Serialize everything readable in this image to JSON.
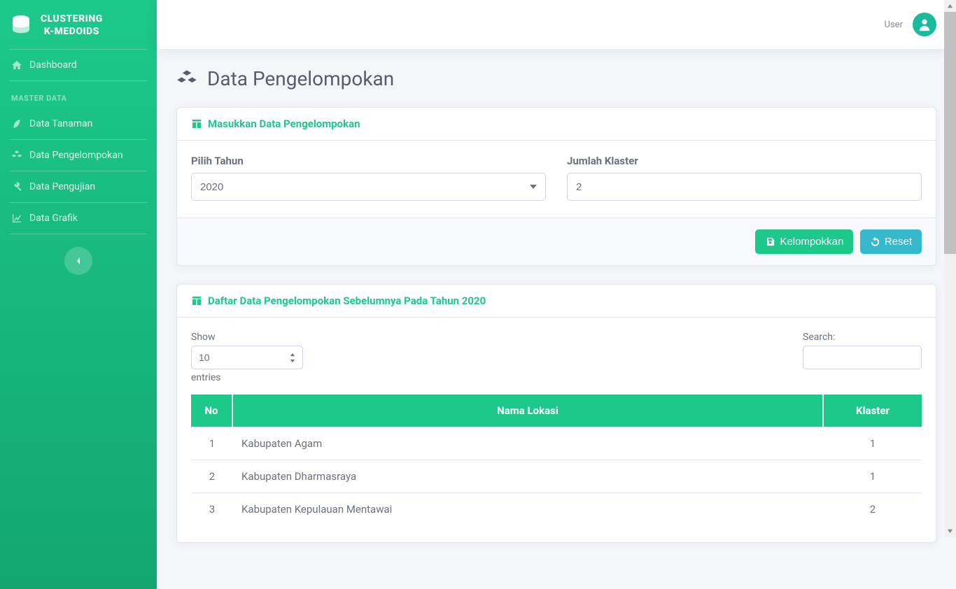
{
  "brand": {
    "line1": "CLUSTERING",
    "line2": "K-MEDOIDS"
  },
  "sidebar": {
    "section_master": "MASTER DATA",
    "items": {
      "dashboard": "Dashboard",
      "tanaman": "Data Tanaman",
      "pengelompokan": "Data Pengelompokan",
      "pengujian": "Data Pengujian",
      "grafik": "Data Grafik"
    }
  },
  "topbar": {
    "user_label": "User"
  },
  "page_title": "Data Pengelompokan",
  "card_input": {
    "title": "Masukkan Data Pengelompokan",
    "label_tahun": "Pilih Tahun",
    "value_tahun": "2020",
    "label_klaster": "Jumlah Klaster",
    "value_klaster": "2",
    "btn_submit": "Kelompokkan",
    "btn_reset": "Reset"
  },
  "card_list": {
    "title": "Daftar Data Pengelompokan Sebelumnya Pada Tahun 2020",
    "dt": {
      "show_label": "Show",
      "entries_label": "entries",
      "length_value": "10",
      "search_label": "Search:"
    },
    "columns": {
      "no": "No",
      "lokasi": "Nama Lokasi",
      "klaster": "Klaster"
    },
    "rows": [
      {
        "no": "1",
        "lokasi": "Kabupaten Agam",
        "klaster": "1"
      },
      {
        "no": "2",
        "lokasi": "Kabupaten Dharmasraya",
        "klaster": "1"
      },
      {
        "no": "3",
        "lokasi": "Kabupaten Kepulauan Mentawai",
        "klaster": "2"
      }
    ]
  }
}
